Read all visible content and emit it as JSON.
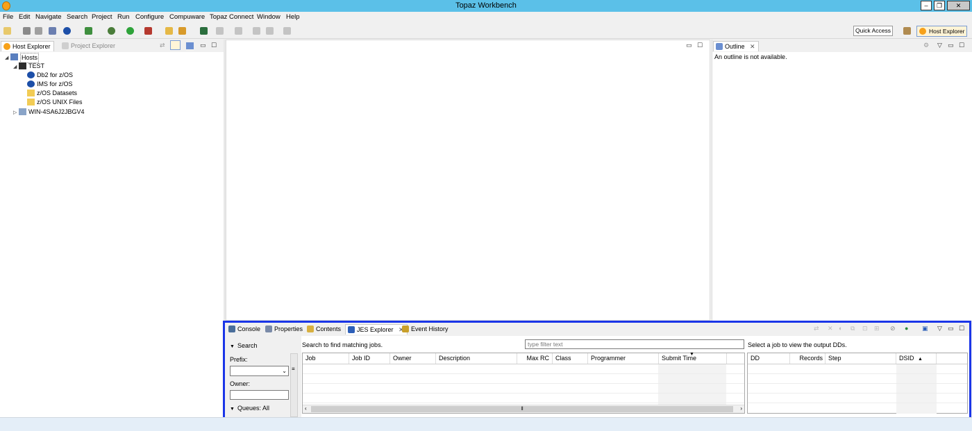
{
  "window": {
    "title": "Topaz Workbench"
  },
  "menu": [
    "File",
    "Edit",
    "Navigate",
    "Search",
    "Project",
    "Run",
    "Configure",
    "Compuware",
    "Topaz Connect",
    "Window",
    "Help"
  ],
  "toolbar": {
    "quick_access": "Quick Access",
    "perspective": "Host Explorer"
  },
  "left_panel": {
    "tabs": [
      {
        "label": "Host Explorer"
      },
      {
        "label": "Project Explorer"
      }
    ],
    "tree": [
      {
        "label": "Hosts"
      },
      {
        "label": "TEST"
      },
      {
        "label": "Db2 for z/OS"
      },
      {
        "label": "IMS for z/OS"
      },
      {
        "label": "z/OS Datasets"
      },
      {
        "label": "z/OS UNIX Files"
      },
      {
        "label": "WIN-4SA6J2JBGV4"
      }
    ]
  },
  "outline": {
    "tab": "Outline",
    "message": "An outline is not available."
  },
  "bottom_panel": {
    "tabs": [
      {
        "label": "Console"
      },
      {
        "label": "Properties"
      },
      {
        "label": "Contents"
      },
      {
        "label": "JES Explorer"
      },
      {
        "label": "Event History"
      }
    ],
    "search": {
      "header": "Search",
      "prefix_label": "Prefix:",
      "owner_label": "Owner:",
      "queues_label": "Queues: All"
    },
    "jobs": {
      "hint": "Search to find matching jobs.",
      "filter_placeholder": "type filter text",
      "columns": [
        "Job",
        "Job ID",
        "Owner",
        "Description",
        "Max RC",
        "Class",
        "Programmer",
        "Submit Time",
        ""
      ]
    },
    "dds": {
      "hint": "Select a job to view the output DDs.",
      "columns": [
        "DD",
        "Records",
        "Step",
        "DSID"
      ]
    }
  },
  "colors": {
    "title_bar": "#5bc0e8",
    "highlight_frame": "#1a35e8"
  }
}
